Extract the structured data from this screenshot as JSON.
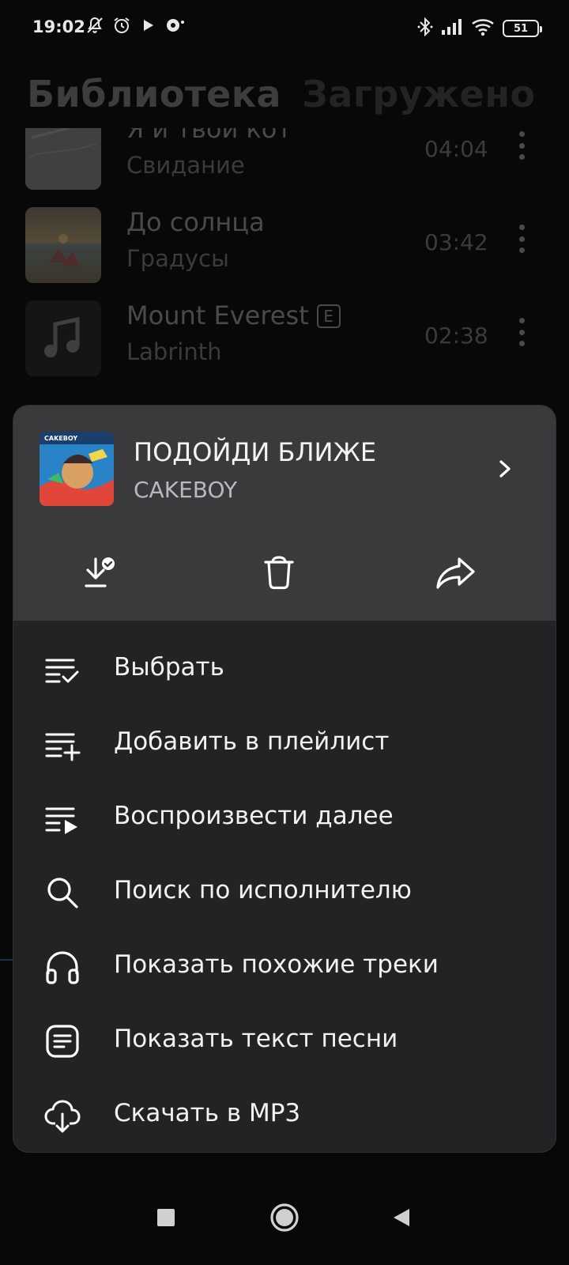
{
  "status_bar": {
    "time": "19:02",
    "left_icons": [
      "notifications-muted-icon",
      "alarm-icon",
      "play-icon",
      "radio-icon"
    ],
    "right_icons": [
      "bluetooth-icon",
      "signal-icon",
      "wifi-icon"
    ],
    "battery": "51"
  },
  "library": {
    "tabs": [
      {
        "label": "Библиотека",
        "active": true
      },
      {
        "label": "Загружено",
        "active": false
      }
    ],
    "tracks": [
      {
        "title": "Я и твой кот",
        "artist": "Свидание",
        "duration": "04:04",
        "explicit": false,
        "cover": "snow-photo"
      },
      {
        "title": "До солнца",
        "artist": "Градусы",
        "duration": "03:42",
        "explicit": false,
        "cover": "sunset-photo"
      },
      {
        "title": "Mount Everest",
        "artist": "Labrinth",
        "duration": "02:38",
        "explicit": true,
        "explicit_badge": "E",
        "cover": "music-note-icon"
      }
    ]
  },
  "sheet": {
    "track_title": "ПОДОЙДИ БЛИЖЕ",
    "track_artist": "CAKEBOY",
    "cover_caption": "CAKEBOY",
    "actions": [
      {
        "name": "downloaded-icon"
      },
      {
        "name": "delete-icon"
      },
      {
        "name": "share-icon"
      }
    ],
    "menu": [
      {
        "label": "Выбрать",
        "icon": "select-list-icon"
      },
      {
        "label": "Добавить в плейлист",
        "icon": "add-to-playlist-icon"
      },
      {
        "label": "Воспроизвести далее",
        "icon": "play-next-icon"
      },
      {
        "label": "Поиск по исполнителю",
        "icon": "search-icon"
      },
      {
        "label": "Показать похожие треки",
        "icon": "headphones-icon"
      },
      {
        "label": "Показать текст песни",
        "icon": "lyrics-icon"
      },
      {
        "label": "Скачать в MP3",
        "icon": "cloud-download-icon"
      }
    ]
  },
  "nav_bar": {
    "buttons": [
      "recents-button",
      "home-button",
      "back-button"
    ]
  },
  "colors": {
    "background": "#080809",
    "sheet_header": "#3a3a3d",
    "sheet_body": "#232326",
    "text_primary": "#f2f2f2",
    "text_secondary": "#b9b9bd"
  }
}
